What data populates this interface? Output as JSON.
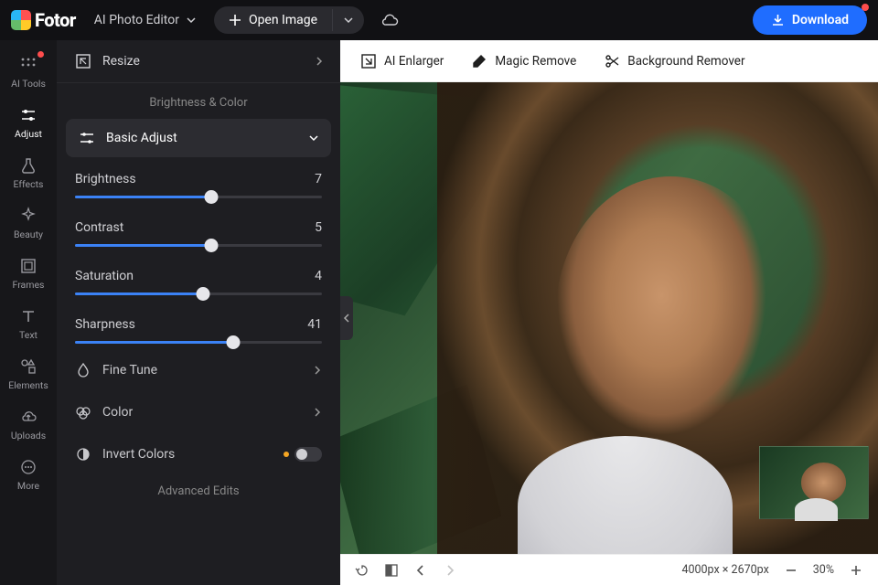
{
  "header": {
    "brand": "Fotor",
    "mode_label": "AI Photo Editor",
    "open_label": "Open Image",
    "download_label": "Download"
  },
  "rail": {
    "items": [
      {
        "id": "ai-tools",
        "label": "AI Tools",
        "badge": true
      },
      {
        "id": "adjust",
        "label": "Adjust",
        "active": true
      },
      {
        "id": "effects",
        "label": "Effects"
      },
      {
        "id": "beauty",
        "label": "Beauty"
      },
      {
        "id": "frames",
        "label": "Frames"
      },
      {
        "id": "text",
        "label": "Text"
      },
      {
        "id": "elements",
        "label": "Elements"
      },
      {
        "id": "uploads",
        "label": "Uploads"
      },
      {
        "id": "more",
        "label": "More"
      }
    ]
  },
  "panel": {
    "resize_label": "Resize",
    "section_header": "Brightness & Color",
    "basic_adjust_label": "Basic Adjust",
    "sliders": [
      {
        "name": "Brightness",
        "value": "7",
        "pct": 55
      },
      {
        "name": "Contrast",
        "value": "5",
        "pct": 55
      },
      {
        "name": "Saturation",
        "value": "4",
        "pct": 52
      },
      {
        "name": "Sharpness",
        "value": "41",
        "pct": 64
      }
    ],
    "fine_tune_label": "Fine Tune",
    "color_label": "Color",
    "invert_label": "Invert Colors",
    "advanced_label": "Advanced Edits"
  },
  "toolbar": {
    "enlarger": "AI Enlarger",
    "magic_remove": "Magic Remove",
    "bg_remove": "Background Remover"
  },
  "status": {
    "dimensions": "4000px × 2670px",
    "zoom": "30%"
  }
}
